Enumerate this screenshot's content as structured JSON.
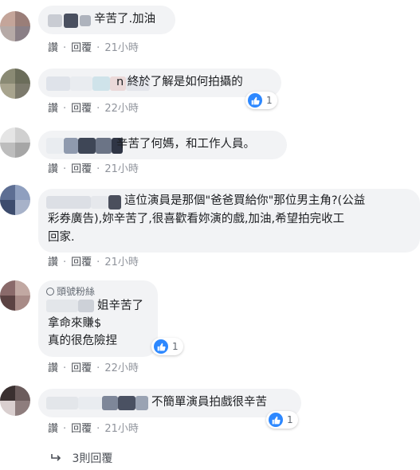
{
  "comments": [
    {
      "text": "辛苦了.加油",
      "actions": {
        "like": "讚",
        "reply": "回覆",
        "time": "21小時"
      },
      "reactions": null
    },
    {
      "text": "n 終於了解是如何拍攝的",
      "actions": {
        "like": "讚",
        "reply": "回覆",
        "time": "22小時"
      },
      "reactions": {
        "icon": "like-icon",
        "count": "1"
      }
    },
    {
      "text": "辛苦了何媽，和工作人員。",
      "actions": {
        "like": "讚",
        "reply": "回覆",
        "time": "21小時"
      },
      "reactions": null
    },
    {
      "lines": [
        "這位演員是那個\"爸爸買給你\"那位男主角?(公益",
        "彩券廣告),妳辛苦了,很喜歡看妳演的戲,加油,希望拍完收工",
        "回家."
      ],
      "actions": {
        "like": "讚",
        "reply": "回覆",
        "time": "21小時"
      },
      "reactions": null
    },
    {
      "badge": "頭號粉絲",
      "lines": [
        "姐辛苦了",
        "拿命來賺$",
        "真的很危險捏"
      ],
      "actions": {
        "like": "讚",
        "reply": "回覆",
        "time": "22小時"
      },
      "reactions": {
        "icon": "like-icon",
        "count": "1"
      }
    },
    {
      "text": "不簡單演員拍戲很辛苦",
      "actions": {
        "like": "讚",
        "reply": "回覆",
        "time": "21小時"
      },
      "reactions": {
        "icon": "like-icon",
        "count": "1"
      }
    }
  ],
  "replies": {
    "icon": "reply-arrow-icon",
    "label": "3則回覆"
  },
  "colors": {
    "bubble": "#f2f3f5",
    "like_blue": "#2d88ff",
    "meta": "#606770"
  }
}
